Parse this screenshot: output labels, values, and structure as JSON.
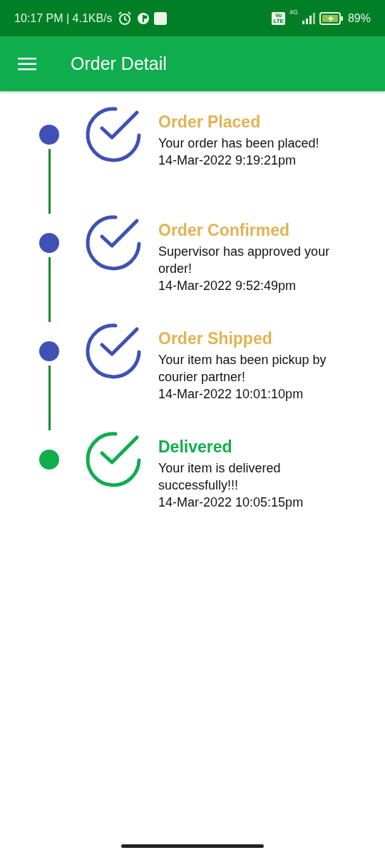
{
  "status_bar": {
    "time": "10:17 PM | 4.1KB/s",
    "volte": [
      "Vo",
      "LTE"
    ],
    "network": "4G",
    "battery": "89%"
  },
  "app_bar": {
    "title": "Order Detail"
  },
  "steps": [
    {
      "title": "Order Placed",
      "message": "Your order has been placed!",
      "time": "14-Mar-2022 9:19:21pm",
      "color": "#3f51b5",
      "kind": "done"
    },
    {
      "title": "Order Confirmed",
      "message": "Supervisor has approved your order!",
      "time": "14-Mar-2022 9:52:49pm",
      "color": "#3f51b5",
      "kind": "done"
    },
    {
      "title": "Order Shipped",
      "message": "Your item has been pickup by courier partner!",
      "time": "14-Mar-2022 10:01:10pm",
      "color": "#3f51b5",
      "kind": "done"
    },
    {
      "title": "Delivered",
      "message": "Your item is delivered successfully!!!",
      "time": "14-Mar-2022 10:05:15pm",
      "color": "#0fad4e",
      "kind": "final"
    }
  ]
}
